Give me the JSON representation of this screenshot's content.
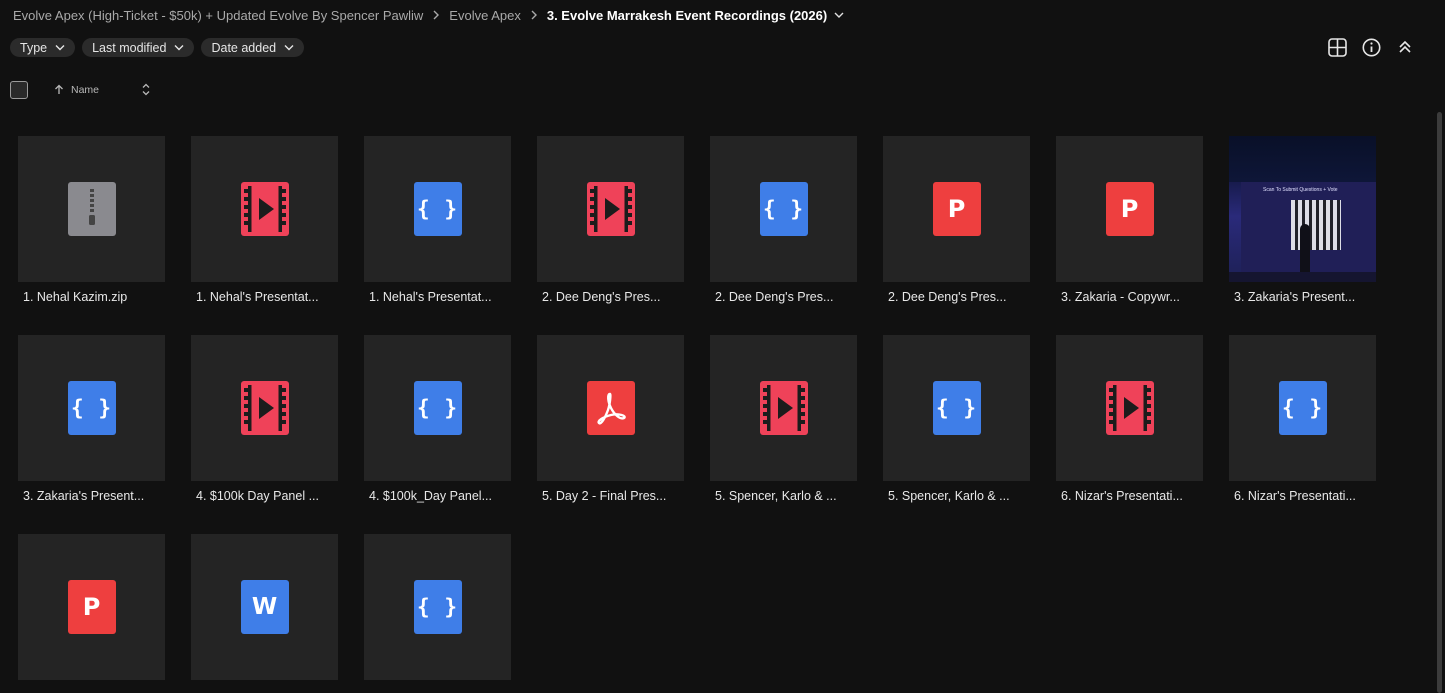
{
  "breadcrumb": {
    "items": [
      {
        "label": "Evolve Apex (High-Ticket - $50k) + Updated Evolve By Spencer Pawliw"
      },
      {
        "label": "Evolve Apex"
      },
      {
        "label": "3. Evolve Marrakesh Event Recordings (2026)"
      }
    ],
    "separator_icon": "chevron-right-icon",
    "current_dropdown_icon": "chevron-down-icon"
  },
  "filters": [
    {
      "label": "Type",
      "icon": "chevron-down-icon"
    },
    {
      "label": "Last modified",
      "icon": "chevron-down-icon"
    },
    {
      "label": "Date added",
      "icon": "chevron-down-icon"
    }
  ],
  "toolbar": {
    "icons": [
      "grid-view-icon",
      "info-icon",
      "collapse-up-icon"
    ]
  },
  "list_header": {
    "column_name": "Name",
    "sort_direction_icon": "arrow-up-icon",
    "sort_toggle_icon": "sort-updown-icon"
  },
  "files": [
    {
      "name": "1. Nehal Kazim.zip",
      "type": "zip"
    },
    {
      "name": "1. Nehal's Presentat...",
      "type": "video"
    },
    {
      "name": "1. Nehal's Presentat...",
      "type": "code"
    },
    {
      "name": "2. Dee Deng's Pres...",
      "type": "video"
    },
    {
      "name": "2. Dee Deng's Pres...",
      "type": "code"
    },
    {
      "name": "2. Dee Deng's Pres...",
      "type": "ppt"
    },
    {
      "name": "3. Zakaria - Copywr...",
      "type": "ppt"
    },
    {
      "name": "3. Zakaria's Present...",
      "type": "image"
    },
    {
      "name": "3. Zakaria's Present...",
      "type": "code"
    },
    {
      "name": "4. $100k Day Panel ...",
      "type": "video"
    },
    {
      "name": "4. $100k_Day Panel...",
      "type": "code"
    },
    {
      "name": "5. Day 2 - Final Pres...",
      "type": "pdf"
    },
    {
      "name": "5. Spencer, Karlo & ...",
      "type": "video"
    },
    {
      "name": "5. Spencer, Karlo & ...",
      "type": "code"
    },
    {
      "name": "6. Nizar's Presentati...",
      "type": "video"
    },
    {
      "name": "6. Nizar's Presentati...",
      "type": "code"
    },
    {
      "name": "",
      "type": "ppt"
    },
    {
      "name": "",
      "type": "word"
    },
    {
      "name": "",
      "type": "code"
    }
  ],
  "file_icons": {
    "zip": {
      "icon": "zip-archive-icon",
      "color": "#8a8a8f"
    },
    "video": {
      "icon": "video-file-icon",
      "color": "#ef4259"
    },
    "code": {
      "icon": "code-file-icon",
      "glyph": "{ }",
      "color": "#3f7ee8"
    },
    "ppt": {
      "icon": "powerpoint-file-icon",
      "glyph": "P",
      "color": "#ee3f3f"
    },
    "word": {
      "icon": "word-file-icon",
      "glyph": "W",
      "color": "#3f7ee8"
    },
    "pdf": {
      "icon": "pdf-file-icon",
      "color": "#ee3f3f"
    },
    "image": {
      "icon": "image-thumbnail",
      "caption": "Scan To Submit Questions + Vote"
    }
  }
}
